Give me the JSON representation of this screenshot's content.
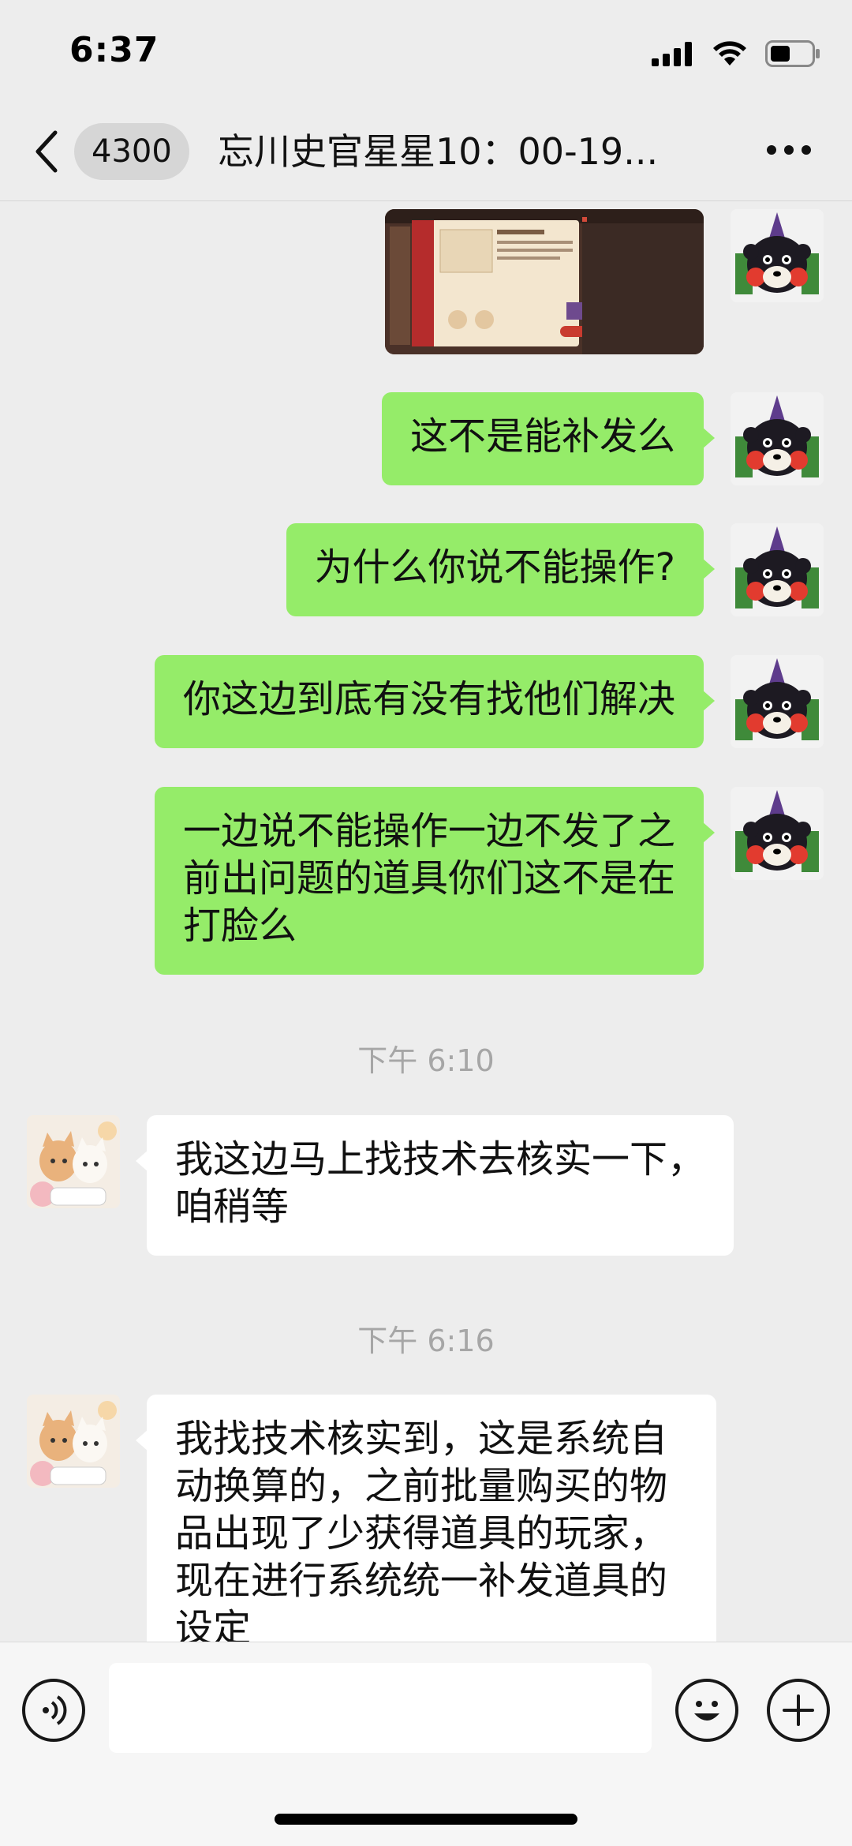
{
  "status": {
    "time": "6:37"
  },
  "nav": {
    "badge": "4300",
    "title": "忘川史官星星10：00-19..."
  },
  "messages": {
    "m1": "这不是能补发么",
    "m2": "为什么你说不能操作?",
    "m3": "你这边到底有没有找他们解决",
    "m4_l1": "一边说不能操作一边不发了之",
    "m4_l2": "前出问题的道具你们这不是在",
    "m4_l3": "打脸么",
    "ts1": "下午 6:10",
    "r1_l1": "我这边马上找技术去核实一下，",
    "r1_l2": "咱稍等",
    "ts2": "下午 6:16",
    "r2_l1": "我找技术核实到，这是系统自",
    "r2_l2": "动换算的，之前批量购买的物",
    "r2_l3": "品出现了少获得道具的玩家，",
    "r2_l4": "现在进行系统统一补发道具的",
    "r2_l5": "设定"
  },
  "input": {
    "value": ""
  },
  "colors": {
    "sent_bubble": "#95ec69",
    "received_bubble": "#ffffff",
    "background": "#ededed"
  },
  "icons": [
    "back-arrow-icon",
    "more-icon",
    "voice-icon",
    "emoji-icon",
    "plus-icon",
    "signal-icon",
    "wifi-icon",
    "battery-icon"
  ]
}
